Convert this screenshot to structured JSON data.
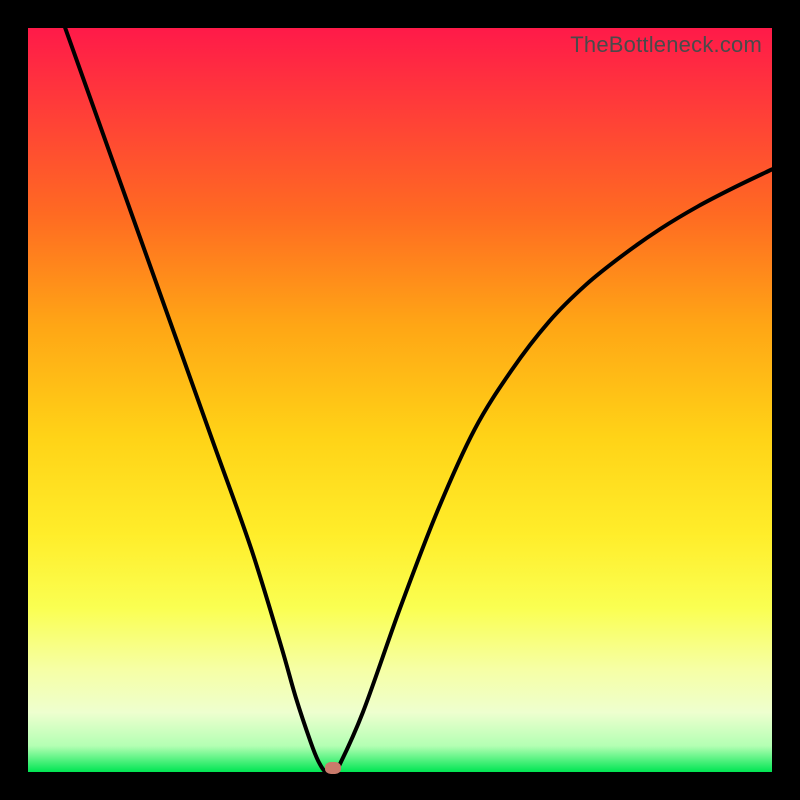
{
  "watermark": "TheBottleneck.com",
  "chart_data": {
    "type": "line",
    "title": "",
    "xlabel": "",
    "ylabel": "",
    "xlim": [
      0,
      100
    ],
    "ylim": [
      0,
      100
    ],
    "series": [
      {
        "name": "curve",
        "x": [
          5,
          10,
          15,
          20,
          25,
          30,
          34,
          36,
          38,
          39,
          40,
          41,
          41.5,
          45,
          50,
          55,
          60,
          65,
          70,
          75,
          80,
          85,
          90,
          95,
          100
        ],
        "y": [
          100,
          86,
          72,
          58,
          44,
          30,
          17,
          10,
          4,
          1.5,
          0,
          0,
          0.2,
          8,
          22,
          35,
          46,
          54,
          60.5,
          65.5,
          69.5,
          73,
          76,
          78.6,
          81
        ]
      }
    ],
    "marker": {
      "x": 41,
      "y": 0,
      "color": "#c97a6b"
    },
    "colors": {
      "gradient_top": "#ff1a49",
      "gradient_bottom": "#00e653",
      "curve": "#000000",
      "frame": "#000000"
    }
  }
}
